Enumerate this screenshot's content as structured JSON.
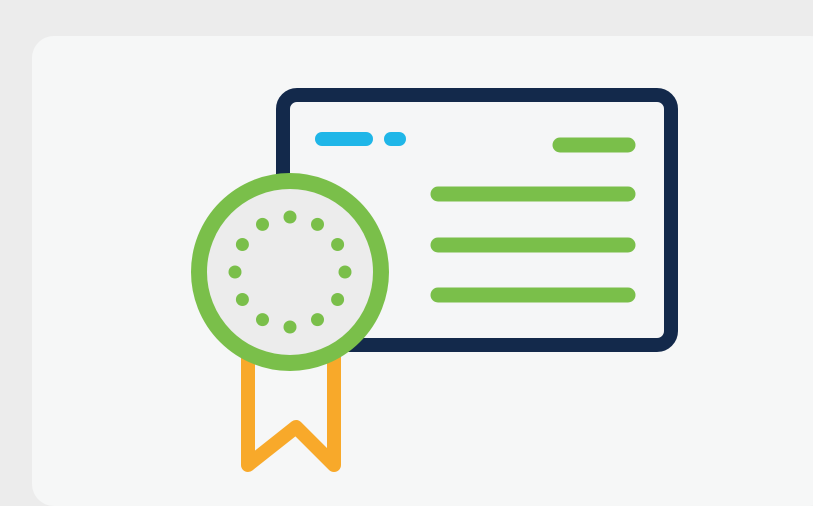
{
  "illustration": {
    "name": "certificate-with-award-ribbon",
    "icon": "certificate-icon",
    "colors": {
      "background": "#ececec",
      "panel": "#f6f7f7",
      "frame": "#13294b",
      "card_fill": "#f5f6f7",
      "accent_blue": "#1fb6e8",
      "accent_green": "#7abf4a",
      "seal_fill": "#ececec",
      "ribbon": "#f8a92a"
    }
  }
}
